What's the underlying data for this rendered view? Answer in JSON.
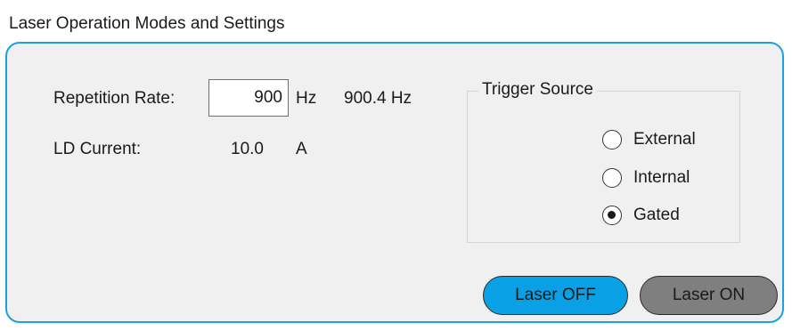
{
  "group": {
    "title": "Laser Operation Modes and Settings"
  },
  "repetition_rate": {
    "label": "Repetition Rate:",
    "value": "900",
    "unit": "Hz",
    "readback": "900.4 Hz"
  },
  "ld_current": {
    "label": "LD Current:",
    "value": "10.0",
    "unit": "A"
  },
  "trigger_source": {
    "title": "Trigger Source",
    "options": [
      {
        "label": "External",
        "selected": false
      },
      {
        "label": "Internal",
        "selected": false
      },
      {
        "label": "Gated",
        "selected": true
      }
    ]
  },
  "buttons": {
    "laser_off": "Laser OFF",
    "laser_on": "Laser ON"
  },
  "colors": {
    "panel_border": "#1ba1e2",
    "panel_background": "#f0f0f0",
    "laser_off_button": "#0aa0e6",
    "laser_on_button": "#7f7f7f"
  }
}
